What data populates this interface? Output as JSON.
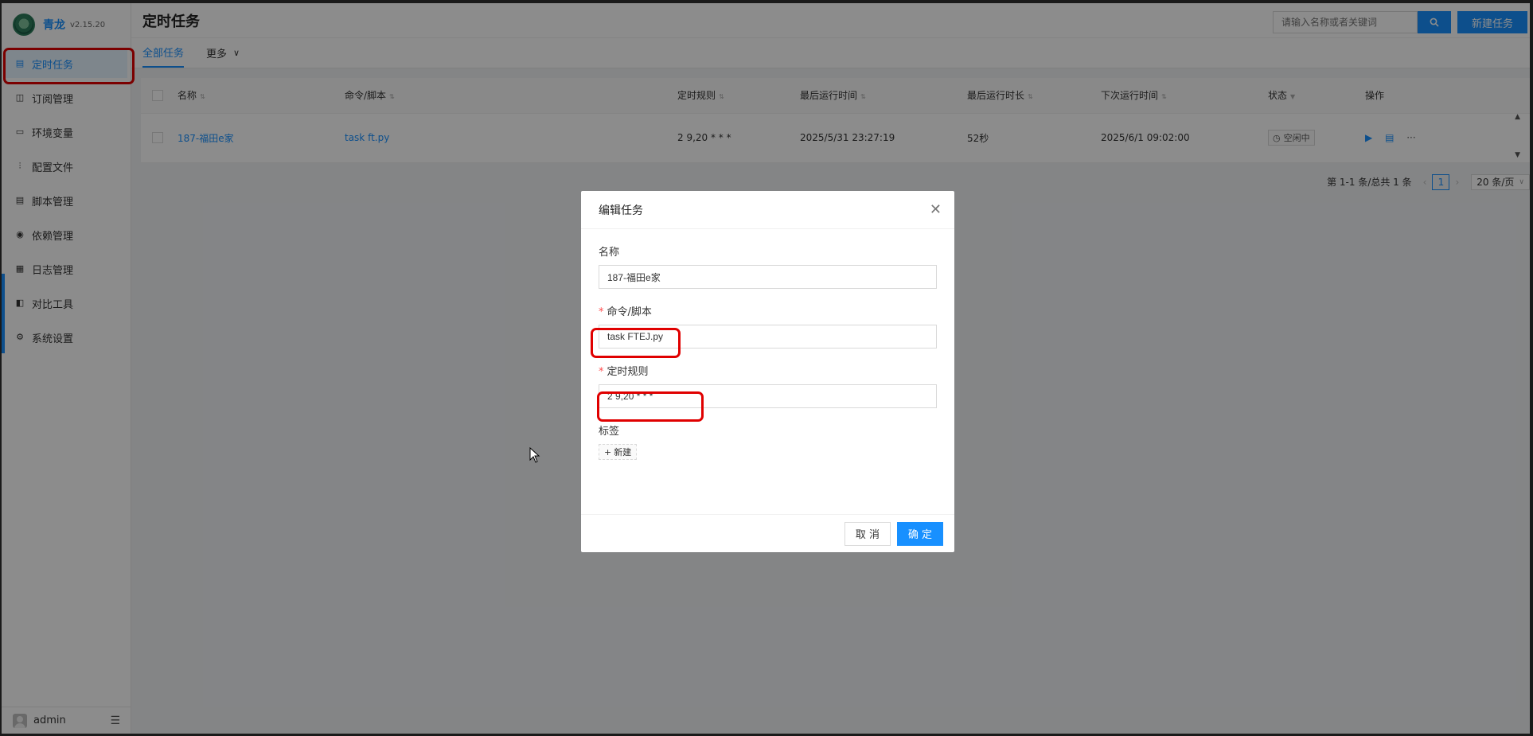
{
  "brand": {
    "name": "青龙",
    "version": "v2.15.20"
  },
  "sidebar": {
    "items": [
      {
        "label": "定时任务",
        "icon": "calendar-icon",
        "active": true
      },
      {
        "label": "订阅管理",
        "icon": "subscription-icon"
      },
      {
        "label": "环境变量",
        "icon": "monitor-icon"
      },
      {
        "label": "配置文件",
        "icon": "sliders-icon"
      },
      {
        "label": "脚本管理",
        "icon": "script-icon"
      },
      {
        "label": "依赖管理",
        "icon": "dependency-icon"
      },
      {
        "label": "日志管理",
        "icon": "log-icon"
      },
      {
        "label": "对比工具",
        "icon": "diff-icon"
      },
      {
        "label": "系统设置",
        "icon": "gear-icon"
      }
    ],
    "user": "admin"
  },
  "header": {
    "title": "定时任务",
    "search_placeholder": "请输入名称或者关键词",
    "new_task_label": "新建任务"
  },
  "tabs": {
    "all": "全部任务",
    "more": "更多"
  },
  "table": {
    "columns": [
      "名称",
      "命令/脚本",
      "定时规则",
      "最后运行时间",
      "最后运行时长",
      "下次运行时间",
      "状态",
      "操作"
    ],
    "rows": [
      {
        "name": "187-福田e家",
        "command": "task ft.py",
        "schedule": "2 9,20 * * *",
        "last_run": "2025/5/31 23:27:19",
        "duration": "52秒",
        "next_run": "2025/6/1 09:02:00",
        "status": "空闲中"
      }
    ]
  },
  "pagination": {
    "summary": "第 1-1 条/总共 1 条",
    "current": "1",
    "page_size": "20 条/页"
  },
  "modal": {
    "title": "编辑任务",
    "name_label": "名称",
    "name_value": "187-福田e家",
    "command_label": "命令/脚本",
    "command_value": "task FTEJ.py",
    "schedule_label": "定时规则",
    "schedule_value": "2 9,20 * * *",
    "tags_label": "标签",
    "tag_add_label": "新建",
    "cancel_label": "取 消",
    "ok_label": "确 定"
  },
  "colors": {
    "primary": "#1890ff",
    "highlight": "#e00000"
  }
}
